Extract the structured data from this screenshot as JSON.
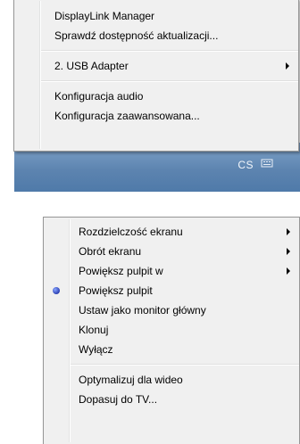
{
  "top_menu": {
    "items": [
      {
        "label": "DisplayLink Manager",
        "has_submenu": false
      },
      {
        "label": "Sprawdź dostępność aktualizacji...",
        "has_submenu": false
      },
      {
        "label": "2. USB Adapter",
        "has_submenu": true
      },
      {
        "label": "Konfiguracja audio",
        "has_submenu": false
      },
      {
        "label": "Konfiguracja zaawansowana...",
        "has_submenu": false
      }
    ]
  },
  "taskbar": {
    "language_indicator": "CS",
    "keyboard_icon": "keyboard-icon"
  },
  "bottom_menu": {
    "items": [
      {
        "label": "Rozdzielczość ekranu",
        "has_submenu": true
      },
      {
        "label": "Obrót ekranu",
        "has_submenu": true
      },
      {
        "label": "Powiększ pulpit w",
        "has_submenu": true
      },
      {
        "label": "Powiększ pulpit",
        "has_submenu": false,
        "selected": true
      },
      {
        "label": "Ustaw jako monitor główny",
        "has_submenu": false
      },
      {
        "label": "Klonuj",
        "has_submenu": false
      },
      {
        "label": "Wyłącz",
        "has_submenu": false
      },
      {
        "label": "Optymalizuj dla wideo",
        "has_submenu": false
      },
      {
        "label": "Dopasuj do TV...",
        "has_submenu": false
      }
    ]
  },
  "colors": {
    "menu_background": "#f0f0f0",
    "taskbar": "#5d84b0",
    "selected_bullet": "#2b3fb3"
  }
}
